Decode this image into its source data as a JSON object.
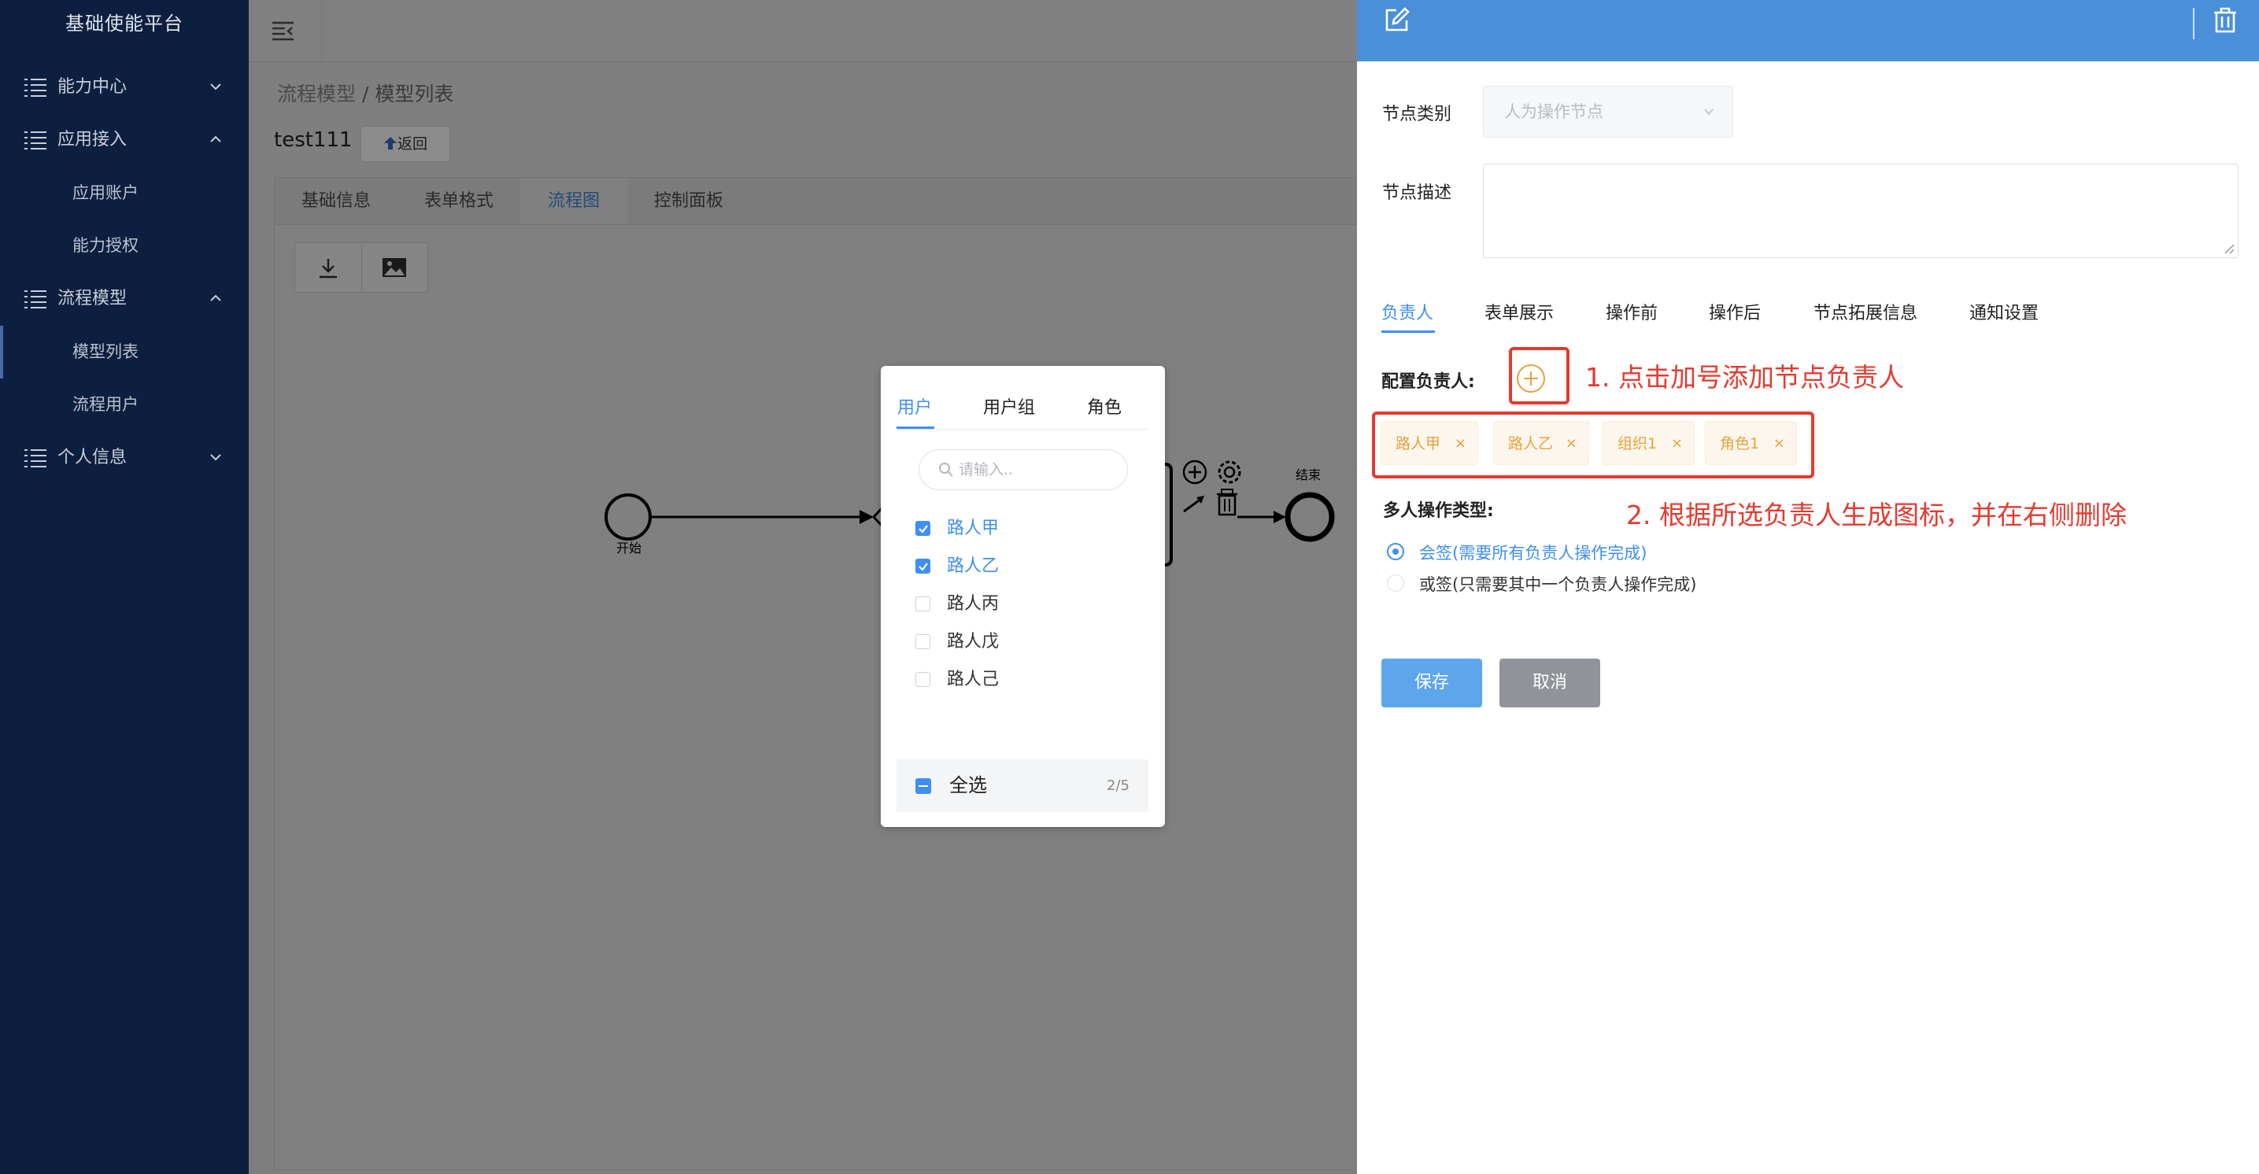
{
  "app": {
    "title": "基础使能平台"
  },
  "sidebar": {
    "items": [
      {
        "label": "能力中心"
      },
      {
        "label": "应用接入"
      },
      {
        "label": "应用账户"
      },
      {
        "label": "能力授权"
      },
      {
        "label": "流程模型"
      },
      {
        "label": "模型列表"
      },
      {
        "label": "流程用户"
      },
      {
        "label": "个人信息"
      }
    ]
  },
  "breadcrumb": {
    "parent": "流程模型",
    "sep": " / ",
    "current": "模型列表"
  },
  "process": {
    "name": "test111",
    "back_label": "返回"
  },
  "main_tabs": [
    {
      "label": "基础信息"
    },
    {
      "label": "表单格式"
    },
    {
      "label": "流程图"
    },
    {
      "label": "控制面板"
    }
  ],
  "diagram": {
    "start_label": "开始",
    "end_label": "结束"
  },
  "modal": {
    "tabs": [
      {
        "label": "用户"
      },
      {
        "label": "用户组"
      },
      {
        "label": "角色"
      }
    ],
    "search_placeholder": "请输入..",
    "items": [
      {
        "label": "路人甲",
        "checked": true
      },
      {
        "label": "路人乙",
        "checked": true
      },
      {
        "label": "路人丙",
        "checked": false
      },
      {
        "label": "路人戊",
        "checked": false
      },
      {
        "label": "路人己",
        "checked": false
      }
    ],
    "select_all_label": "全选",
    "count": "2/5"
  },
  "drawer": {
    "node_type_label": "节点类别",
    "node_type_value": "人为操作节点",
    "node_desc_label": "节点描述",
    "tabs": [
      {
        "label": "负责人"
      },
      {
        "label": "表单展示"
      },
      {
        "label": "操作前"
      },
      {
        "label": "操作后"
      },
      {
        "label": "节点拓展信息"
      },
      {
        "label": "通知设置"
      }
    ],
    "assignee_label": "配置负责人:",
    "chips": [
      {
        "label": "路人甲"
      },
      {
        "label": "路人乙"
      },
      {
        "label": "组织1"
      },
      {
        "label": "角色1"
      }
    ],
    "multi_type_label": "多人操作类型:",
    "options": [
      {
        "label": "会签(需要所有负责人操作完成)",
        "selected": true
      },
      {
        "label": "或签(只需要其中一个负责人操作完成)",
        "selected": false
      }
    ],
    "save_label": "保存",
    "cancel_label": "取消"
  },
  "annotations": {
    "a1": "1. 点击加号添加节点负责人",
    "a2": "2. 根据所选负责人生成图标，并在右侧删除"
  },
  "colors": {
    "primary": "#3f8ef2",
    "annotation": "#e53a2f",
    "sidebar_bg": "#0d1f3f",
    "drawer_header": "#4a90d9"
  }
}
